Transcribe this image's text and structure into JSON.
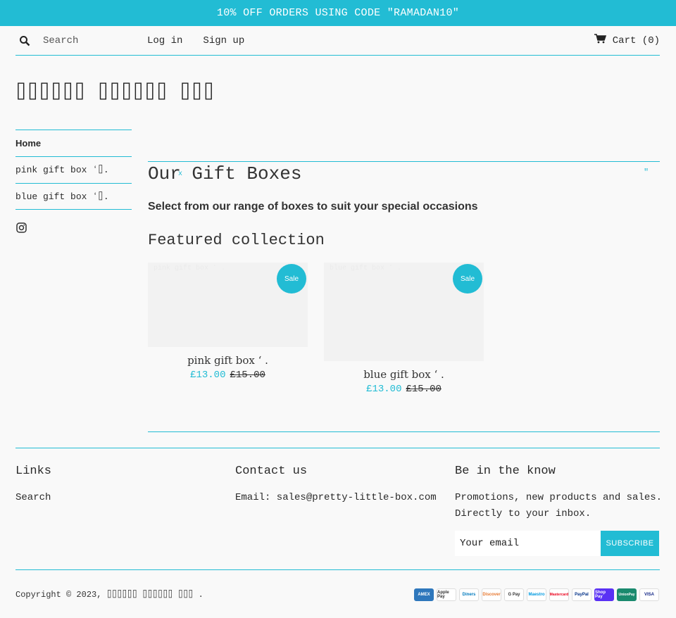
{
  "announcement": "10% OFF ORDERS USING CODE \"RAMADAN10\"",
  "header": {
    "search_placeholder": "Search",
    "login": "Log in",
    "signup": "Sign up",
    "cart": "Cart (0)"
  },
  "logo": "⌷⌷⌷⌷⌷⌷ ⌷⌷⌷⌷⌷⌷ ⌷⌷⌷",
  "sidebar": {
    "items": [
      {
        "label": "Home"
      },
      {
        "label": "pink gift box ʻ⌷."
      },
      {
        "label": "blue gift box ʻ⌷."
      }
    ]
  },
  "main": {
    "title": "Our Gift Boxes",
    "title_mark": "x",
    "title_quote": "\"",
    "subtitle": "Select from our range of boxes to suit your special occasions",
    "featured": "Featured collection",
    "products": [
      {
        "name": "pink gift box ʻ .",
        "ghost": "pink gift box ʻ .",
        "sale_badge": "Sale",
        "price": "£13.00",
        "compare_price": "£15.00"
      },
      {
        "name": "blue gift box ʻ .",
        "ghost": "blue gift box ʻ .",
        "sale_badge": "Sale",
        "price": "£13.00",
        "compare_price": "£15.00"
      }
    ]
  },
  "footer": {
    "links_title": "Links",
    "links": [
      "Search"
    ],
    "contact_title": "Contact us",
    "contact_email": "Email: sales@pretty-little-box.com",
    "know_title": "Be in the know",
    "know_text": "Promotions, new products and sales. Directly to your inbox.",
    "email_placeholder": "Your email",
    "subscribe": "SUBSCRIBE",
    "copyright": "Copyright © 2023, ⌷⌷⌷⌷⌷⌷ ⌷⌷⌷⌷⌷⌷ ⌷⌷⌷  .",
    "payments": [
      "AMEX",
      "Apple Pay",
      "Diners",
      "Discover",
      "G Pay",
      "Maestro",
      "Mastercard",
      "PayPal",
      "Shop Pay",
      "UnionPay",
      "VISA"
    ]
  },
  "colors": {
    "accent": "#22bcd4",
    "background": "#f9f9f9",
    "text": "#2a2a2a"
  }
}
